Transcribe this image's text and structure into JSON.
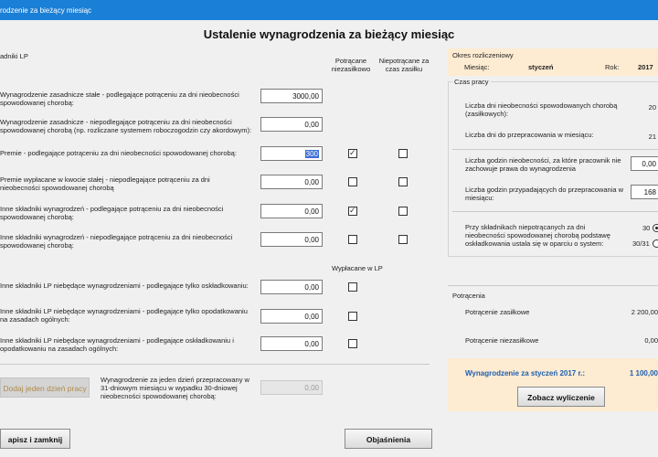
{
  "window": {
    "title": "rodzenie za bieżący miesiąc"
  },
  "heading": "Ustalenie wynagrodzenia za bieżący miesiąc",
  "left": {
    "section_label": "adniki LP",
    "col_header_zas": "Potrącane niezasiłkowo",
    "col_header_niepotr": "Niepotrącane za czas zasiłku",
    "rows": [
      {
        "label": "Wynagrodzenie zasadnicze stałe - podlegające potrąceniu za dni nieobecności spowodowanej chorobą:",
        "value": "3000,00"
      },
      {
        "label": "Wynagrodzenie zasadnicze - niepodlegające potrąceniu za dni nieobecności spowodowanej chorobą (np. rozliczane systemem roboczogodzin czy akordowym):",
        "value": "0,00"
      },
      {
        "label": "Premie - podlegające potrąceniu za dni nieobecności spowodowanej chorobą:",
        "value": "300"
      },
      {
        "label": "Premie wypłacane w kwocie stałej - niepodlegające potrąceniu za dni nieobecności spowodowanej chorobą",
        "value": "0,00"
      },
      {
        "label": "Inne składniki wynagrodzeń - podlegające potrąceniu za dni nieobecności spowodowanej chorobą:",
        "value": "0,00"
      },
      {
        "label": "Inne składniki wynagrodzeń - niepodlegające potrąceniu za dni nieobecności spowodowanej chorobą:",
        "value": "0,00"
      }
    ],
    "wyplacane_header": "Wypłacane w LP",
    "rows2": [
      {
        "label": "Inne składniki LP niebędące wynagrodzeniami - podlegające tylko oskładkowaniu:",
        "value": "0,00"
      },
      {
        "label": "Inne składniki LP niebędące wynagrodzeniami - podlegające tylko opodatkowaniu na zasadach ogólnych:",
        "value": "0,00"
      },
      {
        "label": "Inne składniki LP niebędące wynagrodzeniami - podlegające oskładkowaniu i opodatkowaniu na zasadach ogólnych:",
        "value": "0,00"
      }
    ],
    "add_day_button": "Dodaj jeden dzień pracy",
    "per_day_label": "Wynagrodzenie za jeden dzień przepracowany w 31-dniowym miesiącu w wypadku 30-dniowej nieobecności spowodowanej chorobą:",
    "per_day_value": "0,00"
  },
  "right": {
    "okres_label": "Okres rozliczeniowy",
    "miesiac_label": "Miesiąc:",
    "miesiac_value": "styczeń",
    "rok_label": "Rok:",
    "rok_value": "2017",
    "czas_label": "Czas pracy",
    "czas_rows": [
      {
        "label": "Liczba dni nieobecności spowodowanych chorobą (zasiłkowych):",
        "value": "20"
      },
      {
        "label": "Liczba dni do przepracowania w miesiącu:",
        "value": "21"
      }
    ],
    "godz_rows": [
      {
        "label": "Liczba godzin nieobecności, za które pracownik nie zachowuje prawa do wynagrodzenia",
        "value": "0,00"
      },
      {
        "label": "Liczba godzin przypadających do przepracowania w miesiącu:",
        "value": "168"
      }
    ],
    "radio_label": "Przy składnikach niepotrącanych za dni nieobecności spowodowanej chorobą podstawę oskładkowania ustala się w oparciu o system:",
    "radio_opt1": "30",
    "radio_opt2": "30/31",
    "potracenia_label": "Potrącenia",
    "potr_zas_label": "Potrącenie zasiłkowe",
    "potr_zas_value": "2 200,00",
    "potr_niezas_label": "Potrącenie niezasiłkowe",
    "potr_niezas_value": "0,00",
    "wynagrodzenie_label": "Wynagrodzenie za styczeń 2017 r.:",
    "wynagrodzenie_value": "1 100,00",
    "zobacz_button": "Zobacz wyliczenie"
  },
  "bottom": {
    "zapisz_button": "apisz i zamknij",
    "objasnienia_button": "Objaśnienia"
  },
  "colors": {
    "titlebar": "#1a7fd6",
    "panel": "#fdebd2",
    "accent_text": "#1f5fb0"
  }
}
